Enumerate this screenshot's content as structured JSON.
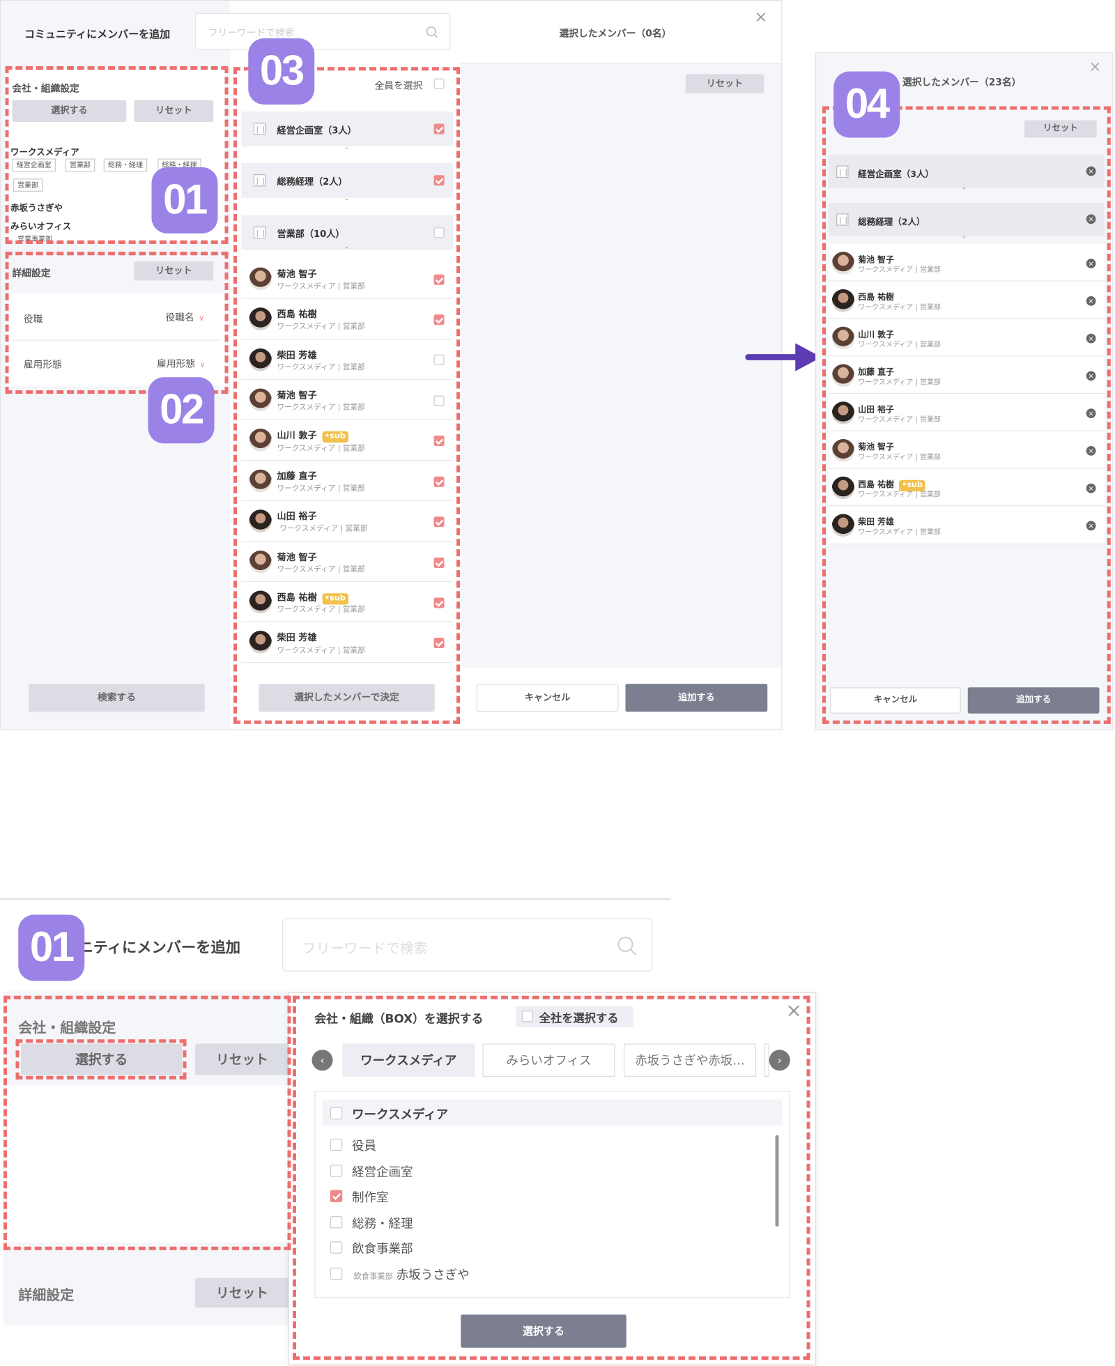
{
  "colors": {
    "accent": "#9b82e6",
    "dash": "#ee6e6e",
    "arrow": "#5b3cb3",
    "primary_button": "#7b7f8f",
    "checked": "#f08a8a"
  },
  "badges": {
    "b1": "01",
    "b2": "02",
    "b3": "03",
    "b4": "04",
    "b5": "01"
  },
  "modal": {
    "title": "コミュニティにメンバーを追加",
    "search_placeholder": "フリーワードで検索",
    "company_section": {
      "title": "会社・組織設定",
      "select_label": "選択する",
      "reset_label": "リセット",
      "groups": [
        {
          "name": "ワークスメディア",
          "tags": [
            "経営企画室",
            "営業部",
            "総務・経理",
            "総務・経理",
            "営業部"
          ]
        },
        {
          "name": "赤坂うさぎや"
        },
        {
          "name": "みらいオフィス",
          "tags": [
            "営業事業部"
          ]
        }
      ]
    },
    "detail_section": {
      "title": "詳細設定",
      "reset_label": "リセット",
      "rows": [
        {
          "label": "役職",
          "value": "役職名"
        },
        {
          "label": "雇用形態",
          "value": "雇用形態"
        }
      ]
    },
    "search_button": "検索する",
    "list": {
      "select_all": "全員を選択",
      "groups": [
        {
          "name": "経営企画室（3人）"
        },
        {
          "name": "総務経理（2人）"
        },
        {
          "name": "営業部（10人）"
        }
      ],
      "members": [
        {
          "name": "菊池 智子",
          "org": "ワークスメディア | 営業部"
        },
        {
          "name": "西島 祐樹",
          "org": "ワークスメディア | 営業部"
        },
        {
          "name": "柴田 芳雄",
          "org": "ワークスメディア | 営業部"
        },
        {
          "name": "菊池 智子",
          "org": "ワークスメディア | 営業部"
        },
        {
          "name": "山川 敦子",
          "org": "ワークスメディア | 営業部",
          "sub": "•sub"
        },
        {
          "name": "加藤 直子",
          "org": "ワークスメディア | 営業部"
        },
        {
          "name": "山田 裕子",
          "org": "ワークスメディア | 営業部"
        },
        {
          "name": "菊池 智子",
          "org": "ワークスメディア | 営業部"
        },
        {
          "name": "西島 祐樹",
          "org": "ワークスメディア | 営業部",
          "sub": "•sub"
        },
        {
          "name": "柴田 芳雄",
          "org": "ワークスメディア | 営業部"
        }
      ],
      "confirm_button": "選択したメンバーで決定"
    },
    "selected": {
      "title": "選択したメンバー（0名）",
      "reset_label": "リセット",
      "cancel_label": "キャンセル",
      "add_label": "追加する"
    }
  },
  "panel4": {
    "title": "選択したメンバー（23名）",
    "reset_label": "リセット",
    "groups": [
      {
        "name": "経営企画室（3人）"
      },
      {
        "name": "総務経理（2人）"
      }
    ],
    "members": [
      {
        "name": "菊池 智子",
        "org": "ワークスメディア | 営業部"
      },
      {
        "name": "西島 祐樹",
        "org": "ワークスメディア | 営業部"
      },
      {
        "name": "山川 敦子",
        "org": "ワークスメディア | 営業部"
      },
      {
        "name": "加藤 直子",
        "org": "ワークスメディア | 営業部"
      },
      {
        "name": "山田 裕子",
        "org": "ワークスメディア | 営業部"
      },
      {
        "name": "菊池 智子",
        "org": "ワークスメディア | 営業部"
      },
      {
        "name": "西島 祐樹",
        "org": "ワークスメディア | 営業部",
        "sub": "•sub"
      },
      {
        "name": "柴田 芳雄",
        "org": "ワークスメディア | 営業部"
      }
    ],
    "cancel_label": "キャンセル",
    "add_label": "追加する"
  },
  "zoom": {
    "title_partial": "ニティにメンバーを追加",
    "search_placeholder": "フリーワードで検索",
    "company_title": "会社・組織設定",
    "select_label": "選択する",
    "reset_label": "リセット",
    "detail_title": "詳細設定",
    "detail_reset": "リセット",
    "picker": {
      "title": "会社・組織（BOX）を選択する",
      "select_all_company": "全社を選択する",
      "tabs": [
        "ワークスメディア",
        "みらいオフィス",
        "赤坂うさぎや赤坂…"
      ],
      "header": "ワークスメディア",
      "items": [
        {
          "label": "役員"
        },
        {
          "label": "経営企画室"
        },
        {
          "label": "制作室"
        },
        {
          "label": "総務・経理"
        },
        {
          "label": "飲食事業部"
        },
        {
          "prefix": "飲食事業部",
          "label": "赤坂うさぎや"
        }
      ],
      "button": "選択する"
    }
  }
}
